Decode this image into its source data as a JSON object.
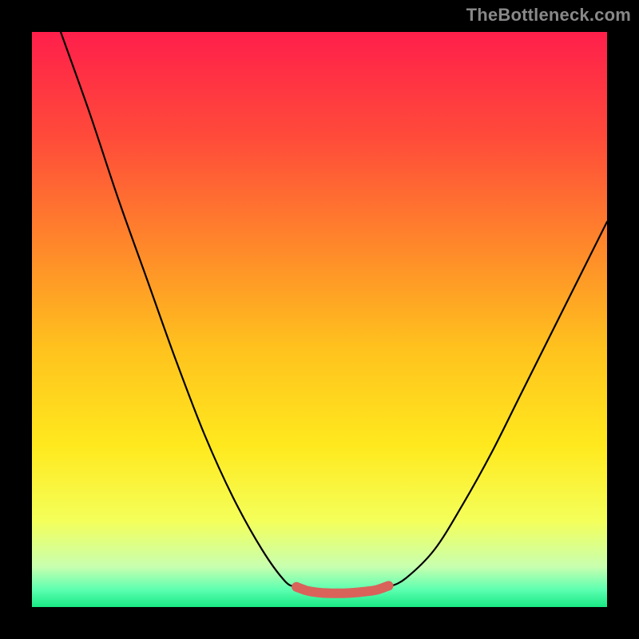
{
  "watermark": "TheBottleneck.com",
  "chart_data": {
    "type": "line",
    "title": "",
    "xlabel": "",
    "ylabel": "",
    "xlim": [
      0,
      100
    ],
    "ylim": [
      0,
      100
    ],
    "grid": false,
    "legend": false,
    "series": [
      {
        "name": "left-curve",
        "color": "#000000",
        "x": [
          5,
          10,
          15,
          20,
          25,
          30,
          35,
          40,
          44,
          46,
          48
        ],
        "y": [
          100,
          86,
          71,
          57,
          43,
          30,
          19,
          10,
          4.5,
          3.5,
          3
        ]
      },
      {
        "name": "right-curve",
        "color": "#000000",
        "x": [
          60,
          62,
          65,
          70,
          75,
          80,
          85,
          90,
          95,
          100
        ],
        "y": [
          3,
          3.5,
          5,
          10,
          18,
          27,
          37,
          47,
          57,
          67
        ]
      },
      {
        "name": "optimal-band",
        "color": "#d9635b",
        "style": "thick",
        "x": [
          46,
          48,
          50,
          52,
          54,
          56,
          58,
          60,
          62
        ],
        "y": [
          3.5,
          2.8,
          2.5,
          2.4,
          2.4,
          2.5,
          2.7,
          3.0,
          3.7
        ]
      }
    ],
    "background_gradient": {
      "stops": [
        {
          "offset": 0.0,
          "color": "#ff1f4b"
        },
        {
          "offset": 0.18,
          "color": "#ff4a3a"
        },
        {
          "offset": 0.38,
          "color": "#ff8a2a"
        },
        {
          "offset": 0.55,
          "color": "#ffc21e"
        },
        {
          "offset": 0.72,
          "color": "#ffe91e"
        },
        {
          "offset": 0.85,
          "color": "#f4ff5a"
        },
        {
          "offset": 0.93,
          "color": "#c8ffb0"
        },
        {
          "offset": 0.97,
          "color": "#5cffb0"
        },
        {
          "offset": 1.0,
          "color": "#18e884"
        }
      ]
    }
  }
}
